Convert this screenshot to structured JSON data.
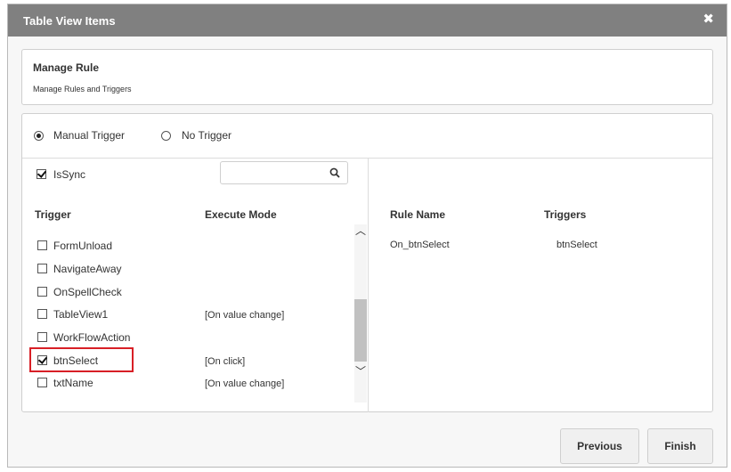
{
  "dialog": {
    "title": "Table View Items",
    "close_glyph": "✖"
  },
  "header": {
    "title": "Manage Rule",
    "subtitle": "Manage Rules and Triggers"
  },
  "trigger_options": {
    "manual_label": "Manual Trigger",
    "none_label": "No Trigger",
    "selected": "Manual Trigger"
  },
  "issync": {
    "label": "IsSync",
    "checked": true
  },
  "search": {
    "value": "",
    "placeholder": ""
  },
  "triggers_table": {
    "col_trigger": "Trigger",
    "col_mode": "Execute Mode",
    "rows": [
      {
        "name": "FormUnload",
        "mode": "",
        "checked": false
      },
      {
        "name": "NavigateAway",
        "mode": "",
        "checked": false
      },
      {
        "name": "OnSpellCheck",
        "mode": "",
        "checked": false
      },
      {
        "name": "TableView1",
        "mode": "[On value change]",
        "checked": false
      },
      {
        "name": "WorkFlowAction",
        "mode": "",
        "checked": false
      },
      {
        "name": "btnSelect",
        "mode": "[On click]",
        "checked": true
      },
      {
        "name": "txtName",
        "mode": "[On value change]",
        "checked": false
      }
    ]
  },
  "rules_table": {
    "col_rule": "Rule Name",
    "col_triggers": "Triggers",
    "rows": [
      {
        "rule": "On_btnSelect",
        "triggers": "btnSelect"
      }
    ]
  },
  "footer": {
    "previous_label": "Previous",
    "finish_label": "Finish"
  },
  "icons": {
    "search": "search-icon",
    "close": "close-icon",
    "scroll_up": "chevron-up-icon",
    "scroll_down": "chevron-down-icon"
  },
  "colors": {
    "titlebar": "#808080",
    "highlight": "#d81f26"
  }
}
